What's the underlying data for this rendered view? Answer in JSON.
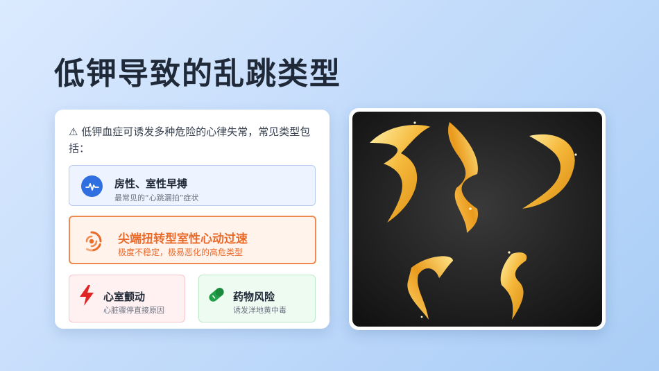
{
  "slide": {
    "title": "低钾导致的乱跳类型"
  },
  "card": {
    "intro_icon": "warning-icon",
    "intro": "⚠  低钾血症可诱发多种危险的心律失常，常见类型包括：",
    "items": [
      {
        "title": "房性、室性早搏",
        "subtitle": "最常见的“心跳漏拍”症状",
        "icon": "heartbeat-icon",
        "accent": "#2f6fdf"
      },
      {
        "title": "尖端扭转型室性心动过速",
        "subtitle": "极度不稳定，极易恶化的高危类型",
        "icon": "spiral-icon",
        "accent": "#ea6a2a"
      },
      {
        "title": "心室颤动",
        "subtitle": "心脏骤停直接原因",
        "icon": "lightning-icon",
        "accent": "#e02424"
      },
      {
        "title": "药物风险",
        "subtitle": "诱发洋地黄中毒",
        "icon": "pill-icon",
        "accent": "#22a049"
      }
    ]
  },
  "image": {
    "subject": "golden-ribbons-image",
    "background": "#1a1a1a"
  }
}
